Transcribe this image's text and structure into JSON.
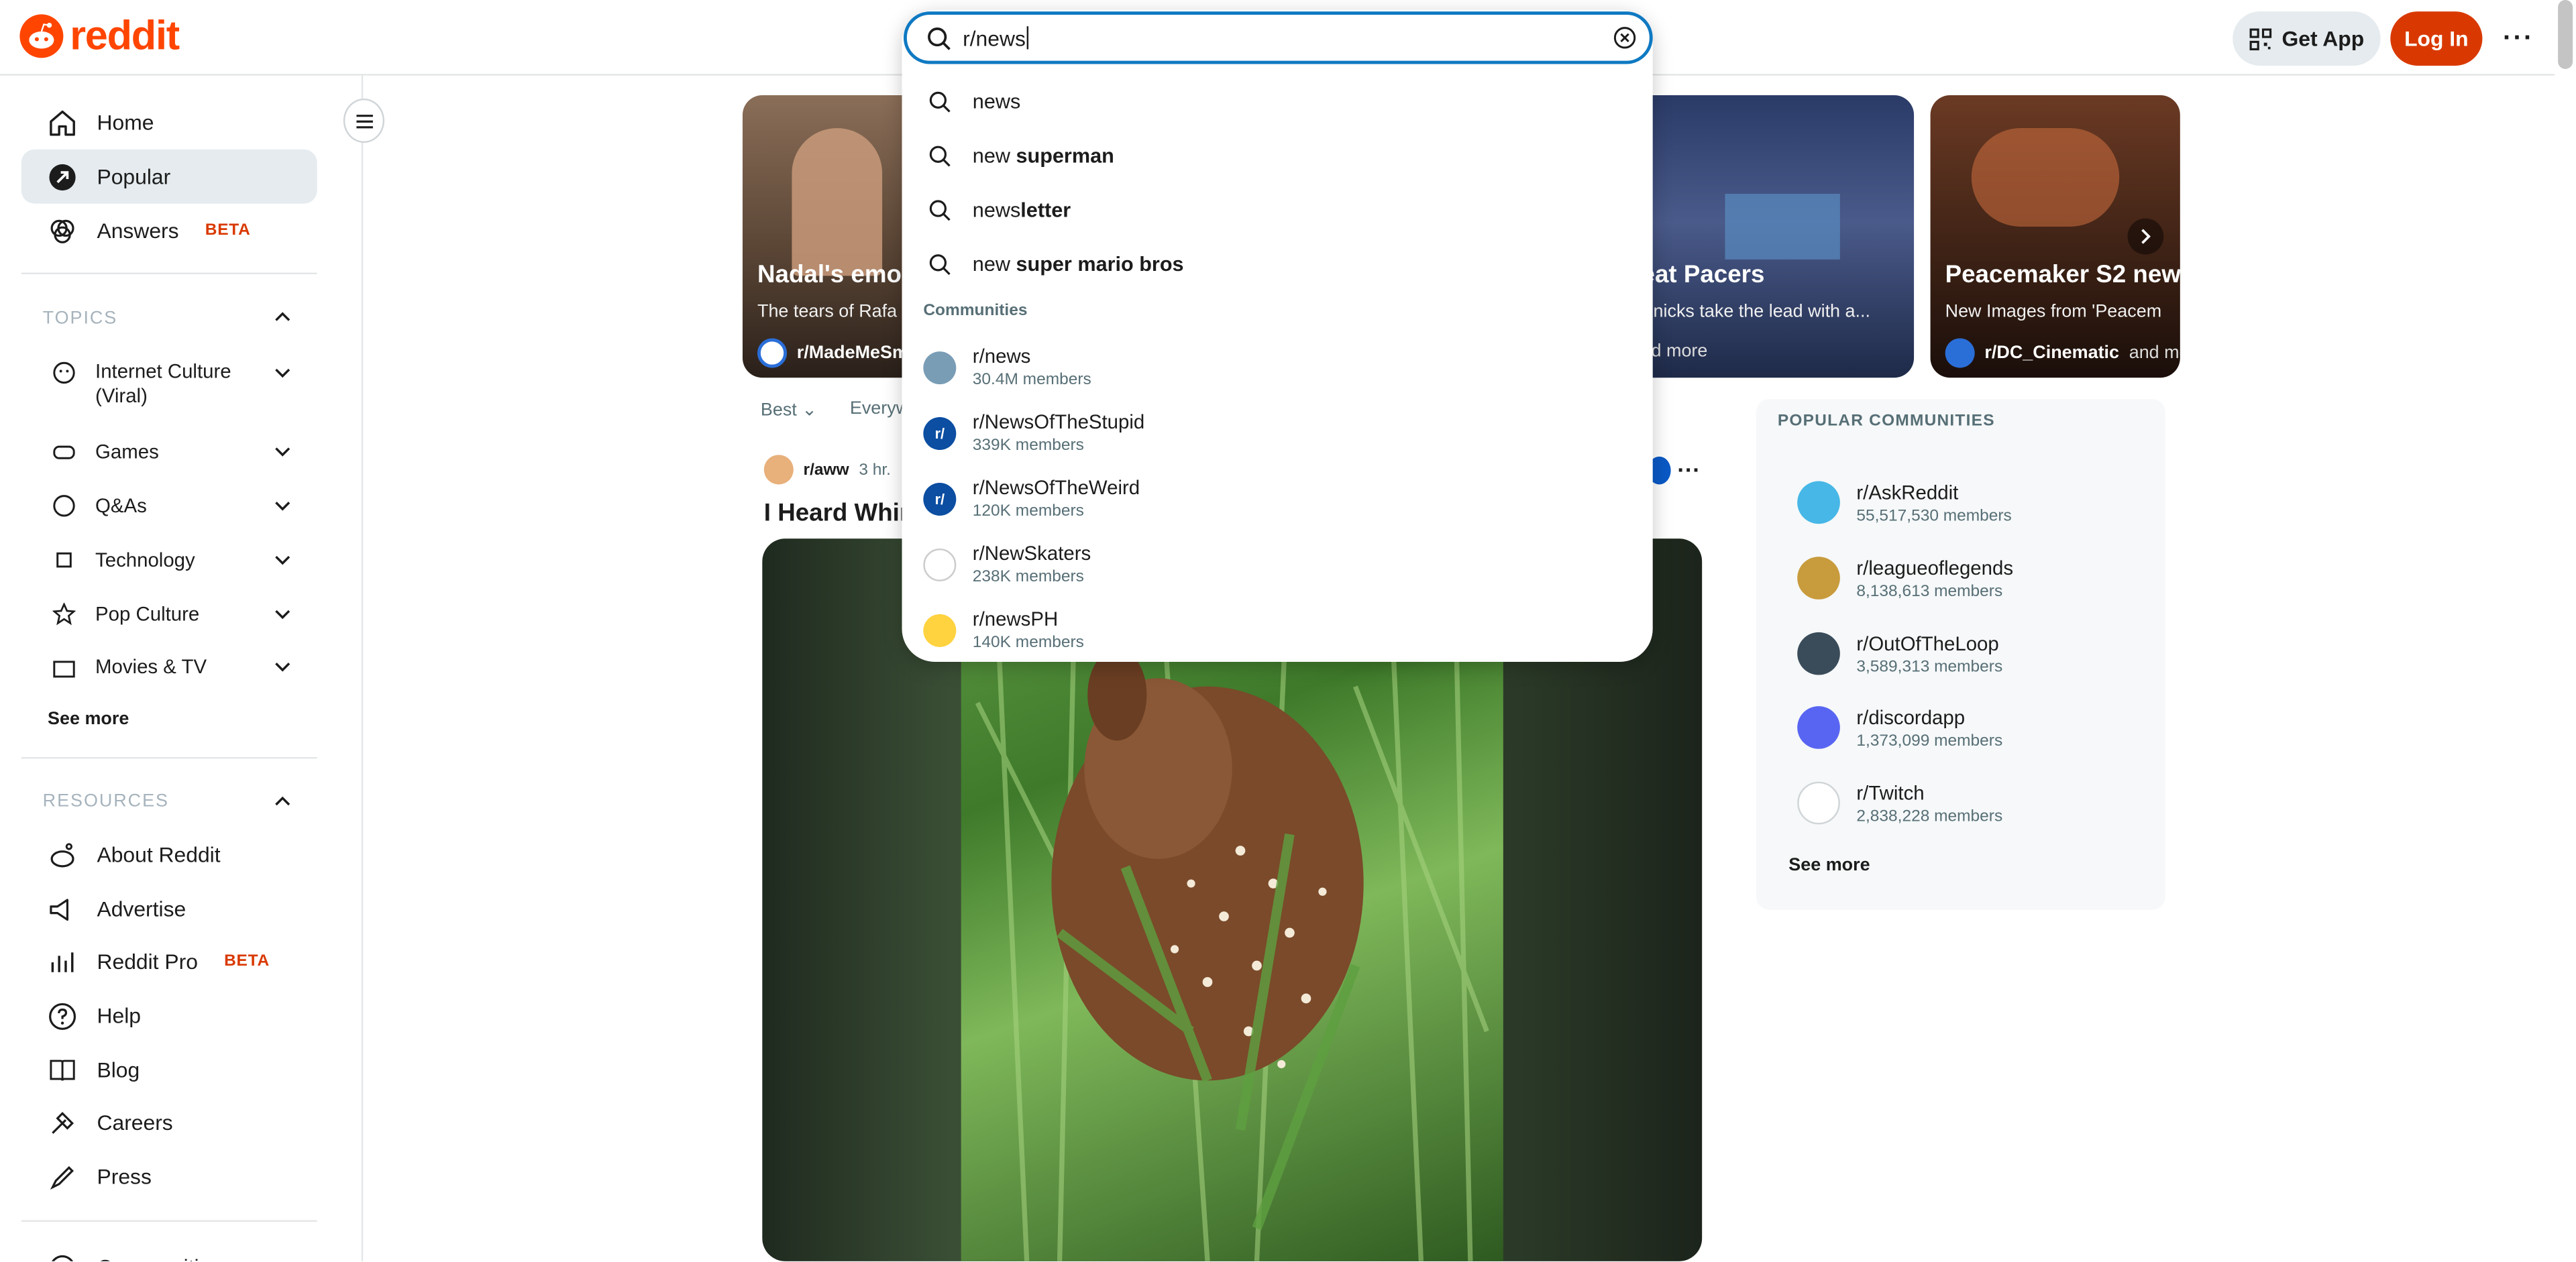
{
  "header": {
    "logo_text": "reddit",
    "get_app_label": "Get App",
    "login_label": "Log In",
    "more_label": "···"
  },
  "search": {
    "value": "r/news",
    "suggestions": [
      {
        "prefix": "new",
        "rest": "s",
        "full": "news"
      },
      {
        "prefix": "new",
        "rest": " superman",
        "full": "new superman"
      },
      {
        "prefix": "news",
        "rest": "letter",
        "full": "newsletter"
      },
      {
        "prefix": "new",
        "rest": " super mario bros",
        "full": "new super mario bros"
      }
    ],
    "communities_heading": "Communities",
    "communities": [
      {
        "name": "r/news",
        "members": "30.4M members",
        "color": "#7a9db6"
      },
      {
        "name": "r/NewsOfTheStupid",
        "members": "339K members",
        "color": "#0b4ea2"
      },
      {
        "name": "r/NewsOfTheWeird",
        "members": "120K members",
        "color": "#0b4ea2"
      },
      {
        "name": "r/NewSkaters",
        "members": "238K members",
        "color": "#ffffff"
      },
      {
        "name": "r/newsPH",
        "members": "140K members",
        "color": "#ffd23f"
      }
    ]
  },
  "sidebar": {
    "nav": [
      {
        "label": "Home",
        "icon": "home-icon"
      },
      {
        "label": "Popular",
        "icon": "popular-icon"
      },
      {
        "label": "Answers",
        "icon": "answers-icon",
        "badge": "BETA"
      }
    ],
    "topics_heading": "TOPICS",
    "topics": [
      {
        "label": "Internet Culture (Viral)"
      },
      {
        "label": "Games"
      },
      {
        "label": "Q&As"
      },
      {
        "label": "Technology"
      },
      {
        "label": "Pop Culture"
      },
      {
        "label": "Movies & TV"
      }
    ],
    "see_more": "See more",
    "resources_heading": "RESOURCES",
    "resources": [
      {
        "label": "About Reddit",
        "icon": "about-icon"
      },
      {
        "label": "Advertise",
        "icon": "advertise-icon"
      },
      {
        "label": "Reddit Pro",
        "icon": "reddit-pro-icon",
        "badge": "BETA"
      },
      {
        "label": "Help",
        "icon": "help-icon"
      },
      {
        "label": "Blog",
        "icon": "blog-icon"
      },
      {
        "label": "Careers",
        "icon": "careers-icon"
      },
      {
        "label": "Press",
        "icon": "press-icon"
      }
    ],
    "communities_partial": "Communities"
  },
  "carousel": [
    {
      "title": "Nadal's emo",
      "subtitle": "The tears of Rafa",
      "subreddit": "r/MadeMeSm"
    },
    {
      "title": "eat Pacers",
      "subtitle": "Knicks take the lead with a...",
      "subreddit": "nd more"
    },
    {
      "title": "Peacemaker S2 new",
      "subtitle": "New Images from 'Peacem",
      "subreddit": "r/DC_Cinematic",
      "extra": "and mo"
    }
  ],
  "feed": {
    "sort_label": "Best",
    "location_label": "Everyw",
    "post": {
      "subreddit": "r/aww",
      "time": "3 hr.",
      "title": "I Heard Whin"
    }
  },
  "popular_communities": {
    "heading": "POPULAR COMMUNITIES",
    "items": [
      {
        "name": "r/AskReddit",
        "members": "55,517,530 members",
        "color": "#46b7e6"
      },
      {
        "name": "r/leagueoflegends",
        "members": "8,138,613 members",
        "color": "#c89b3c"
      },
      {
        "name": "r/OutOfTheLoop",
        "members": "3,589,313 members",
        "color": "#3a4c5a"
      },
      {
        "name": "r/discordapp",
        "members": "1,373,099 members",
        "color": "#5865f2"
      },
      {
        "name": "r/Twitch",
        "members": "2,838,228 members",
        "color": "#ffffff"
      }
    ],
    "see_more": "See more"
  },
  "colors": {
    "brand": "#ff4500",
    "login_bg": "#d93900",
    "search_focus": "#0f79c2"
  }
}
